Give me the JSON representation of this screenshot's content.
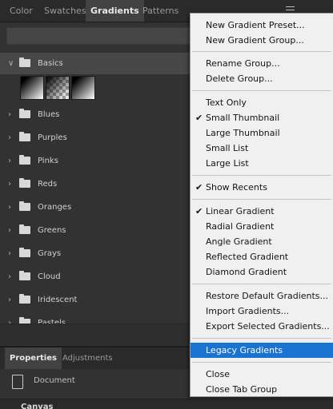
{
  "panel_tabs": [
    "Color",
    "Swatches",
    "Gradients",
    "Patterns"
  ],
  "search": {
    "value": ""
  },
  "groups": [
    {
      "label": "Basics",
      "expanded": true
    },
    {
      "label": "Blues"
    },
    {
      "label": "Purples"
    },
    {
      "label": "Pinks"
    },
    {
      "label": "Reds"
    },
    {
      "label": "Oranges"
    },
    {
      "label": "Greens"
    },
    {
      "label": "Grays"
    },
    {
      "label": "Cloud"
    },
    {
      "label": "Iridescent"
    },
    {
      "label": "Pastels"
    }
  ],
  "bottom_tabs": [
    "Properties",
    "Adjustments"
  ],
  "properties": {
    "document_label": "Document",
    "section_label": "Canvas"
  },
  "menu": {
    "items": [
      {
        "label": "New Gradient Preset..."
      },
      {
        "label": "New Gradient Group..."
      },
      {
        "label": "Rename Group..."
      },
      {
        "label": "Delete Group..."
      },
      {
        "label": "Text Only"
      },
      {
        "label": "Small Thumbnail",
        "checked": true
      },
      {
        "label": "Large Thumbnail"
      },
      {
        "label": "Small List"
      },
      {
        "label": "Large List"
      },
      {
        "label": "Show Recents",
        "checked": true
      },
      {
        "label": "Linear Gradient",
        "checked": true
      },
      {
        "label": "Radial Gradient"
      },
      {
        "label": "Angle Gradient"
      },
      {
        "label": "Reflected Gradient"
      },
      {
        "label": "Diamond Gradient"
      },
      {
        "label": "Restore Default Gradients..."
      },
      {
        "label": "Import Gradients..."
      },
      {
        "label": "Export Selected Gradients..."
      },
      {
        "label": "Legacy Gradients",
        "highlighted": true
      },
      {
        "label": "Close"
      },
      {
        "label": "Close Tab Group"
      }
    ]
  },
  "colors": {
    "menu_highlight": "#1a73d1",
    "panel_bg": "#323232",
    "menu_bg": "#f0f0f0"
  }
}
